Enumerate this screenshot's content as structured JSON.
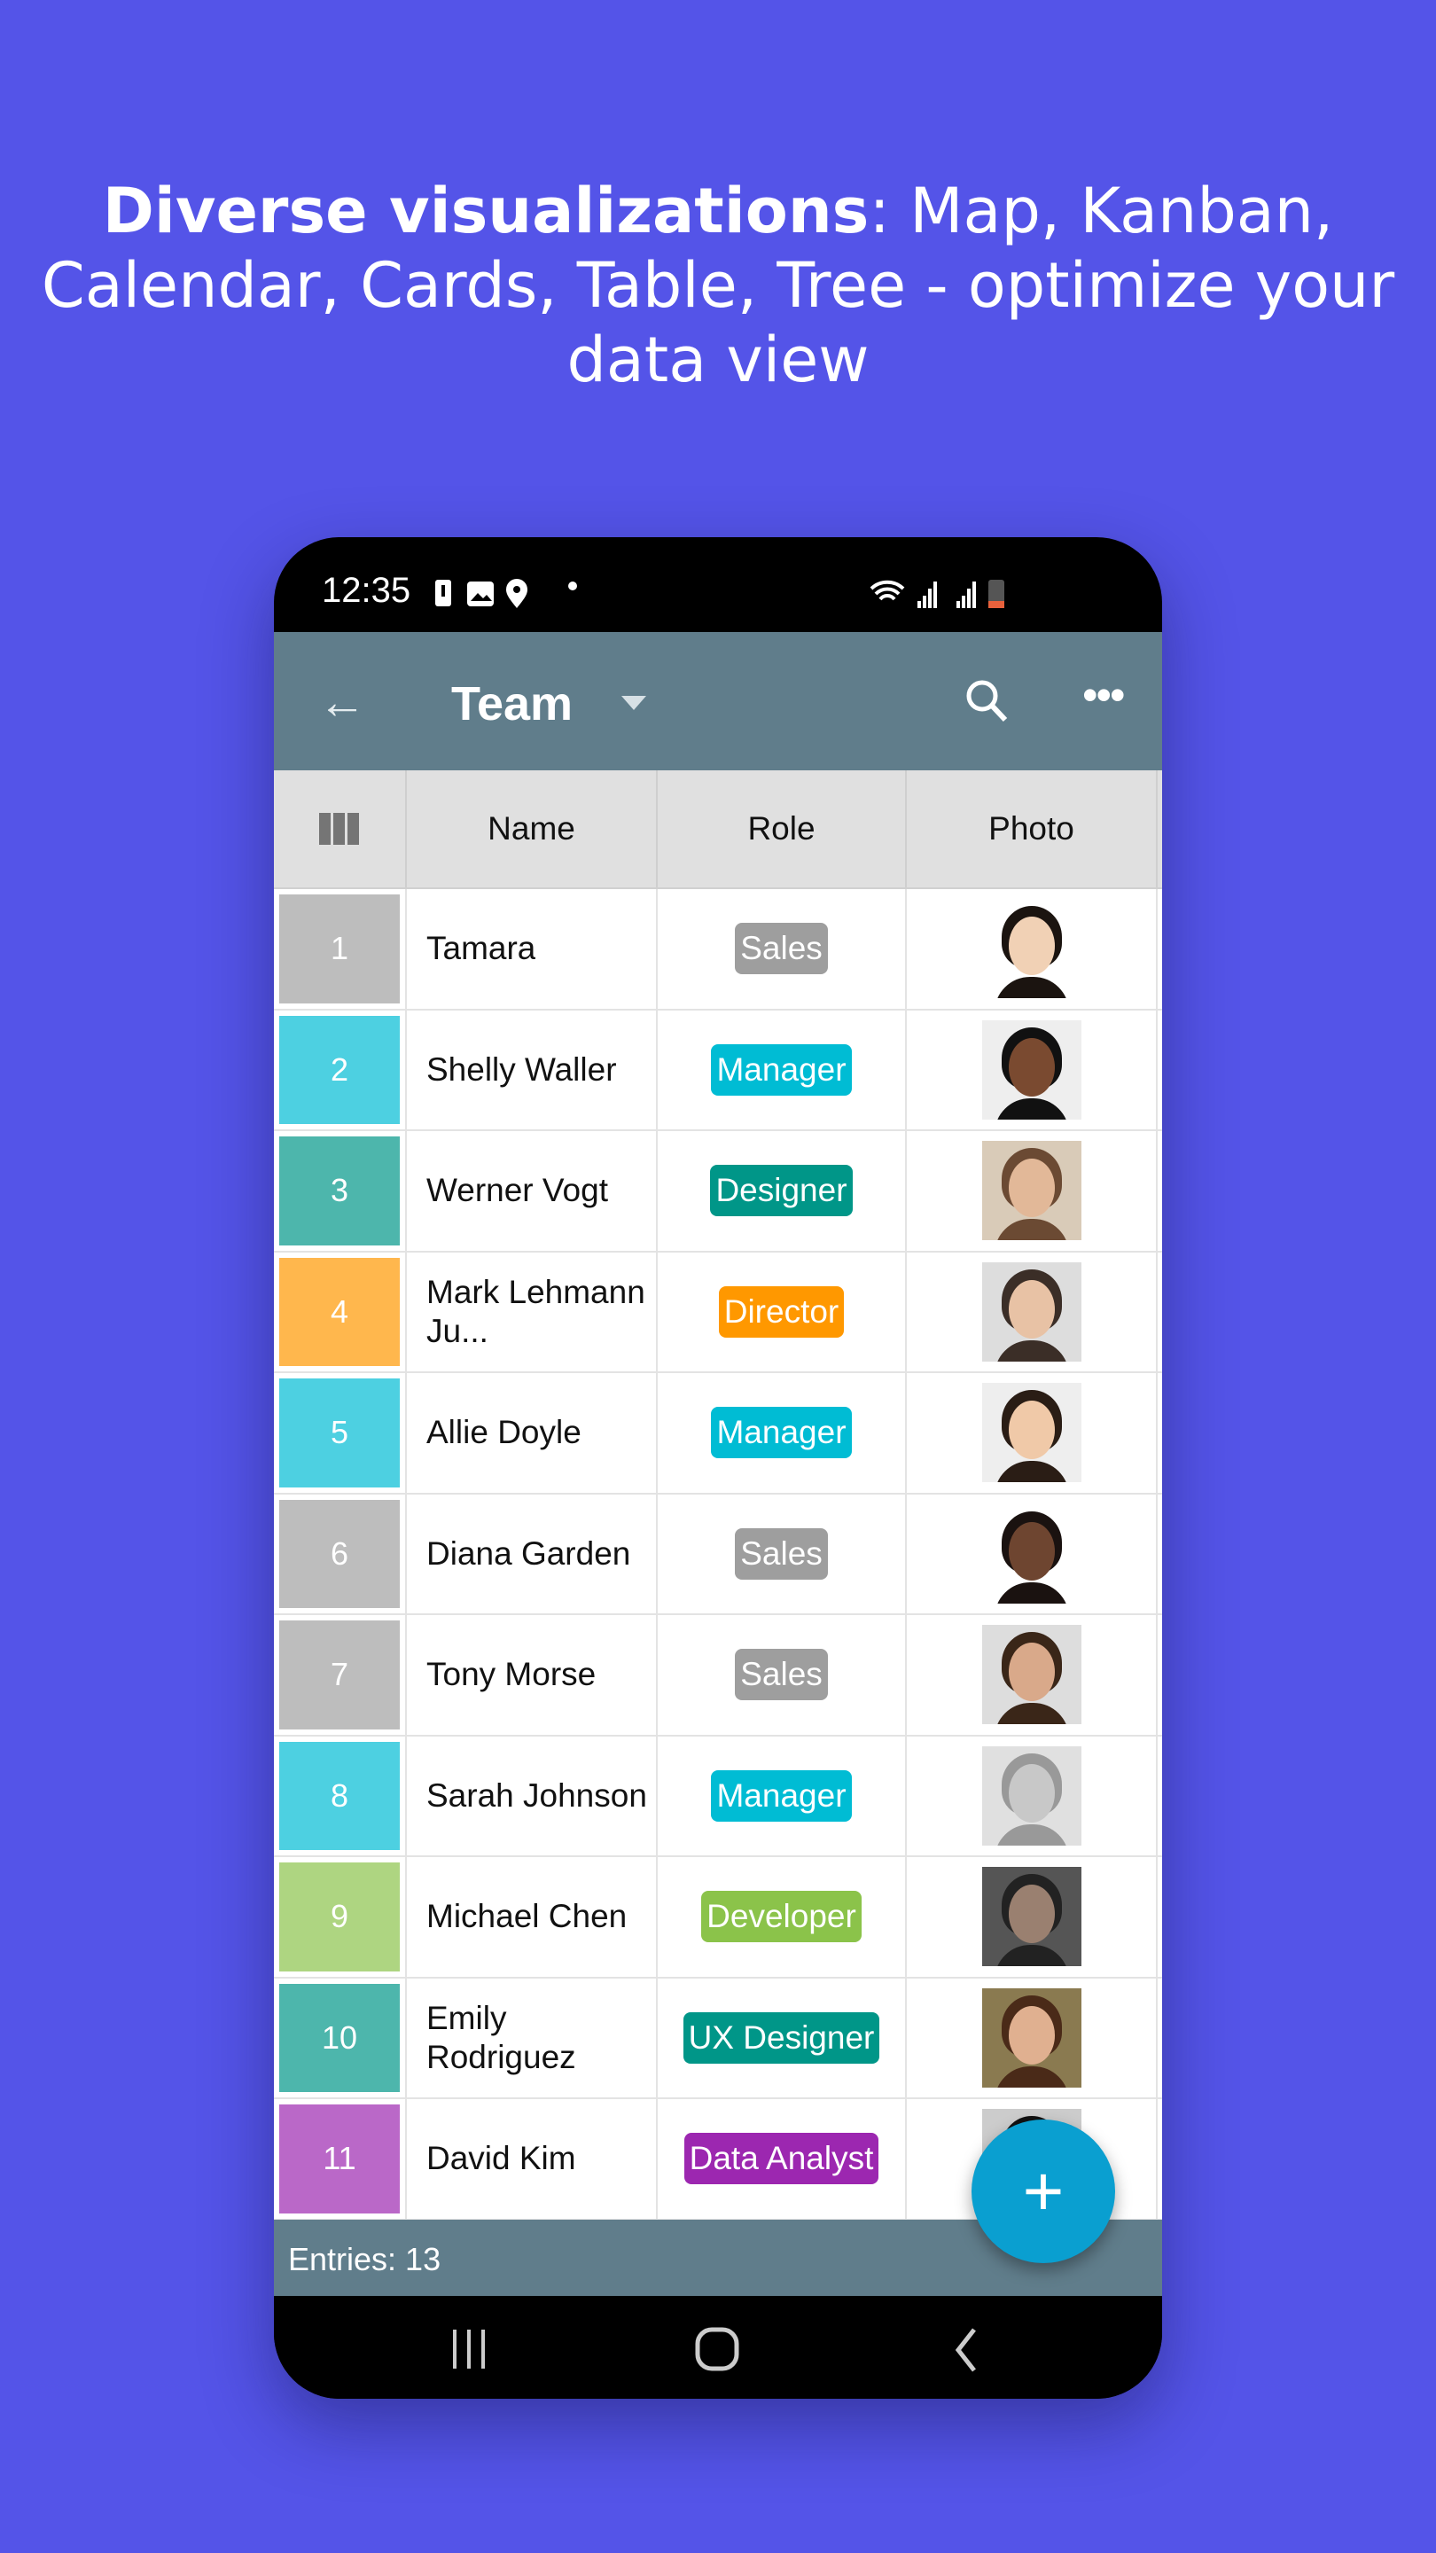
{
  "headline": {
    "bold": "Diverse visualizations",
    "rest": ": Map, Kanban, Calendar, Cards, Table, Tree - optimize your data view"
  },
  "status_bar": {
    "time": "12:35"
  },
  "app_bar": {
    "title": "Team",
    "icons": [
      "back-arrow-icon",
      "dropdown-caret-icon",
      "search-icon",
      "more-icon"
    ]
  },
  "table": {
    "columns": [
      "Name",
      "Role",
      "Photo"
    ],
    "rows": [
      {
        "n": "1",
        "name": "Tamara",
        "role": "Sales",
        "cell": "#BDBDBD",
        "badge": "#9E9E9E"
      },
      {
        "n": "2",
        "name": "Shelly Waller",
        "role": "Manager",
        "cell": "#4DD0E1",
        "badge": "#00BCD4"
      },
      {
        "n": "3",
        "name": "Werner Vogt",
        "role": "Designer",
        "cell": "#4DB6AC",
        "badge": "#009688"
      },
      {
        "n": "4",
        "name": "Mark Lehmann Ju...",
        "role": "Director",
        "cell": "#FFB74D",
        "badge": "#FF9800"
      },
      {
        "n": "5",
        "name": "Allie Doyle",
        "role": "Manager",
        "cell": "#4DD0E1",
        "badge": "#00BCD4"
      },
      {
        "n": "6",
        "name": "Diana Garden",
        "role": "Sales",
        "cell": "#BDBDBD",
        "badge": "#9E9E9E"
      },
      {
        "n": "7",
        "name": "Tony Morse",
        "role": "Sales",
        "cell": "#BDBDBD",
        "badge": "#9E9E9E"
      },
      {
        "n": "8",
        "name": "Sarah Johnson",
        "role": "Manager",
        "cell": "#4DD0E1",
        "badge": "#00BCD4"
      },
      {
        "n": "9",
        "name": "Michael Chen",
        "role": "Developer",
        "cell": "#AED581",
        "badge": "#8BC34A"
      },
      {
        "n": "10",
        "name": "Emily Rodriguez",
        "role": "UX Designer",
        "cell": "#4DB6AC",
        "badge": "#009688"
      },
      {
        "n": "11",
        "name": "David Kim",
        "role": "Data Analyst",
        "cell": "#BA68C8",
        "badge": "#9C27B0"
      }
    ]
  },
  "footer": {
    "entries": "Entries: 13"
  },
  "fab": {
    "label": "+"
  },
  "colors": {
    "background": "#5454E8",
    "app_bar": "#607D8B",
    "fab": "#0A9FD0"
  }
}
